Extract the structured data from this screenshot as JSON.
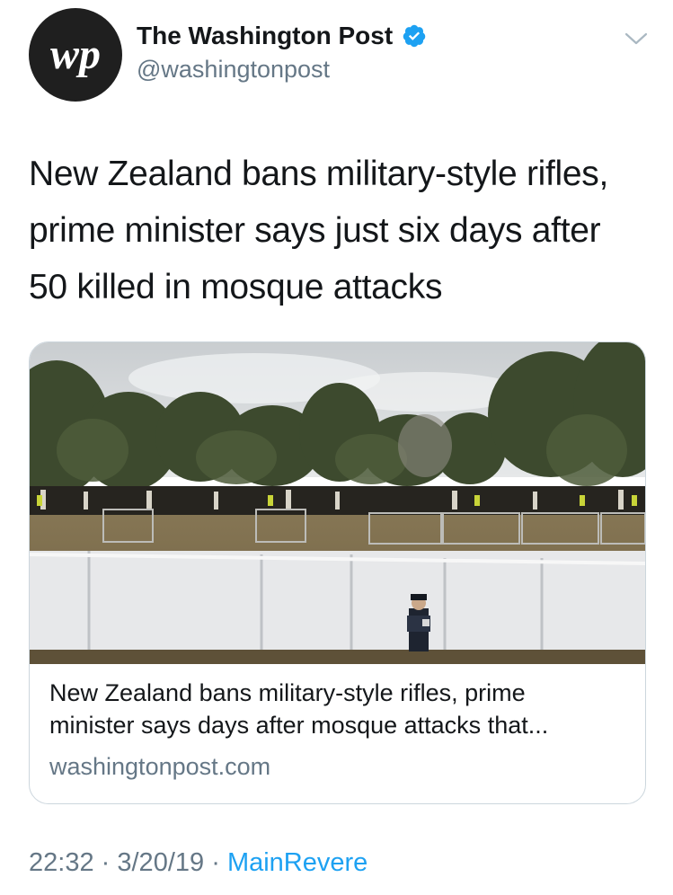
{
  "tweet": {
    "author": {
      "display_name": "The Washington Post",
      "handle": "@washingtonpost",
      "verified": true,
      "avatar_logo_text": "wp"
    },
    "text_lines": [
      "New Zealand bans military-style rifles,",
      "prime minister says just six days after",
      "50 killed in mosque attacks"
    ],
    "card": {
      "title_lines": [
        "New Zealand bans military-style rifles, prime",
        "minister says days after mosque attacks that..."
      ],
      "domain": "washingtonpost.com"
    },
    "meta": {
      "time": "22:32",
      "separator": "·",
      "date": "3/20/19",
      "source": "MainRevere"
    }
  },
  "icons": {
    "verified": "verified-badge-icon",
    "menu": "chevron-down-icon"
  },
  "colors": {
    "text": "#14171a",
    "secondary": "#657786",
    "link": "#1da1f2",
    "verified": "#1da1f2",
    "border": "#ccd6dd"
  }
}
